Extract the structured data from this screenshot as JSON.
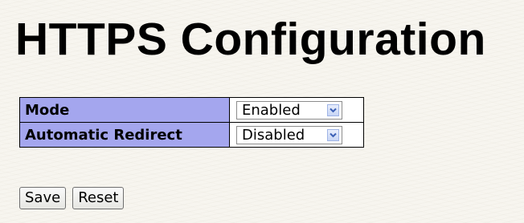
{
  "page": {
    "title": "HTTPS Configuration"
  },
  "settings": [
    {
      "label": "Mode",
      "selected": "Enabled"
    },
    {
      "label": "Automatic Redirect",
      "selected": "Disabled"
    }
  ],
  "icons": {
    "dropdown": "chevron-down-icon"
  },
  "colors": {
    "label_background": "#a4a6ee",
    "page_background": "#f7f5ef"
  },
  "buttons": {
    "save_label": "Save",
    "reset_label": "Reset"
  }
}
